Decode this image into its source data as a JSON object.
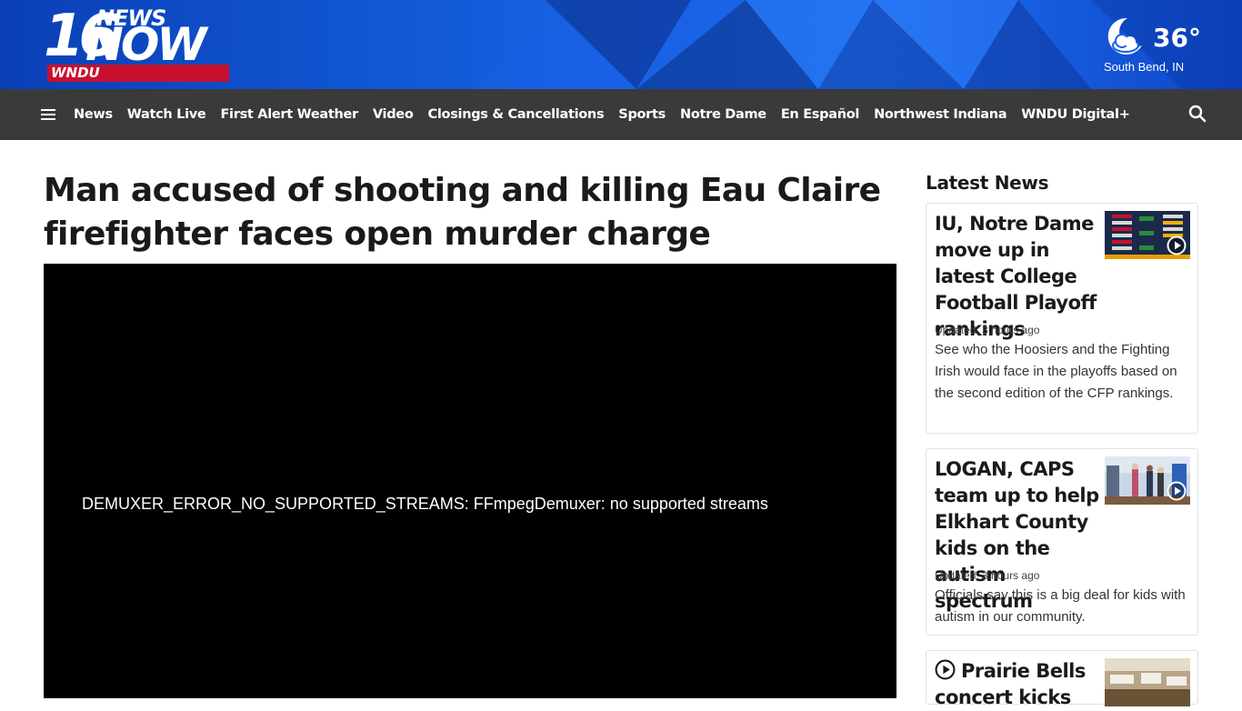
{
  "brand": {
    "logo_number": "16",
    "logo_news": "NEWS",
    "logo_now": "NOW",
    "logo_call": "WNDU",
    "band_color": "#c8102e"
  },
  "weather": {
    "icon": "moon-cloud-icon",
    "temperature": "36°",
    "location": "South Bend, IN"
  },
  "nav": {
    "menu_icon": "hamburger-menu-icon",
    "items": [
      "News",
      "Watch Live",
      "First Alert Weather",
      "Video",
      "Closings & Cancellations",
      "Sports",
      "Notre Dame",
      "En Español",
      "Northwest Indiana",
      "WNDU Digital+"
    ],
    "search_icon": "search-icon"
  },
  "article": {
    "headline": "Man accused of shooting and killing Eau Claire firefighter faces open murder charge",
    "video_error": "DEMUXER_ERROR_NO_SUPPORTED_STREAMS: FFmpegDemuxer: no supported streams"
  },
  "sidebar": {
    "title": "Latest News",
    "cards": [
      {
        "title": "IU, Notre Dame move up in latest College Football Playoff rankings",
        "updated_label": "Updated:",
        "updated_time": "3 hours ago",
        "description": "See who the Hoosiers and the Fighting Irish would face in the playoffs based on the second edition of the CFP rankings.",
        "has_video": true
      },
      {
        "title": "LOGAN, CAPS team up to help Elkhart County kids on the autism spectrum",
        "updated_label": "Updated:",
        "updated_time": "3 hours ago",
        "description": "Officials say this is a big deal for kids with autism in our community.",
        "has_video": true
      },
      {
        "title": "Prairie Bells concert kicks",
        "has_video": true
      }
    ]
  }
}
